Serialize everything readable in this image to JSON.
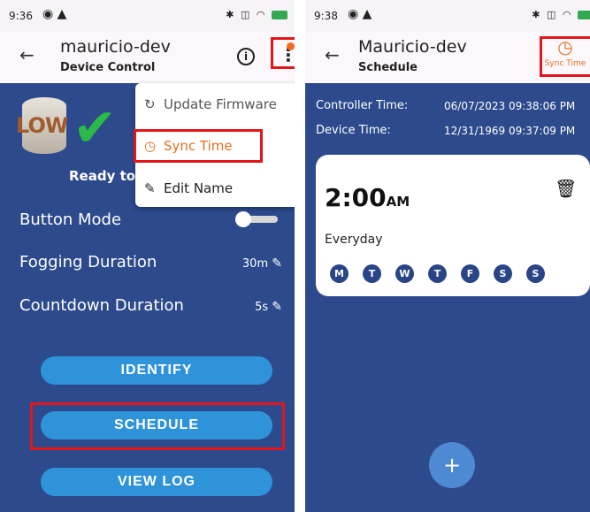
{
  "left": {
    "status": {
      "time": "9:36"
    },
    "appbar": {
      "title": "mauricio-dev",
      "subtitle": "Device Control"
    },
    "status_card": {
      "level_label": "LOW",
      "ready_text": "Ready to"
    },
    "menu": {
      "items": [
        {
          "label": "Update Firmware",
          "icon": "refresh-icon"
        },
        {
          "label": "Sync Time",
          "icon": "clock-icon"
        },
        {
          "label": "Edit Name",
          "icon": "pencil-icon"
        }
      ]
    },
    "settings": [
      {
        "label": "Button Mode",
        "value": ""
      },
      {
        "label": "Fogging Duration",
        "value": "30m"
      },
      {
        "label": "Countdown Duration",
        "value": "5s"
      }
    ],
    "actions": {
      "identify": "IDENTIFY",
      "schedule": "SCHEDULE",
      "view_log": "VIEW LOG"
    }
  },
  "right": {
    "status": {
      "time": "9:38"
    },
    "appbar": {
      "title": "Mauricio-dev",
      "subtitle": "Schedule",
      "sync_label": "Sync Time"
    },
    "times": {
      "controller_label": "Controller Time:",
      "controller_value": "06/07/2023 09:38:06 PM",
      "device_label": "Device Time:",
      "device_value": "12/31/1969 09:37:09 PM"
    },
    "schedule": {
      "time": "2:00",
      "ampm": "AM",
      "repeat": "Everyday",
      "days": [
        "M",
        "T",
        "W",
        "T",
        "F",
        "S",
        "S"
      ]
    },
    "fab_label": "+"
  },
  "colors": {
    "background_blue": "#2c4a8c",
    "button_blue": "#2e93d9",
    "highlight_red": "#e0161b",
    "accent_orange": "#e07020"
  }
}
